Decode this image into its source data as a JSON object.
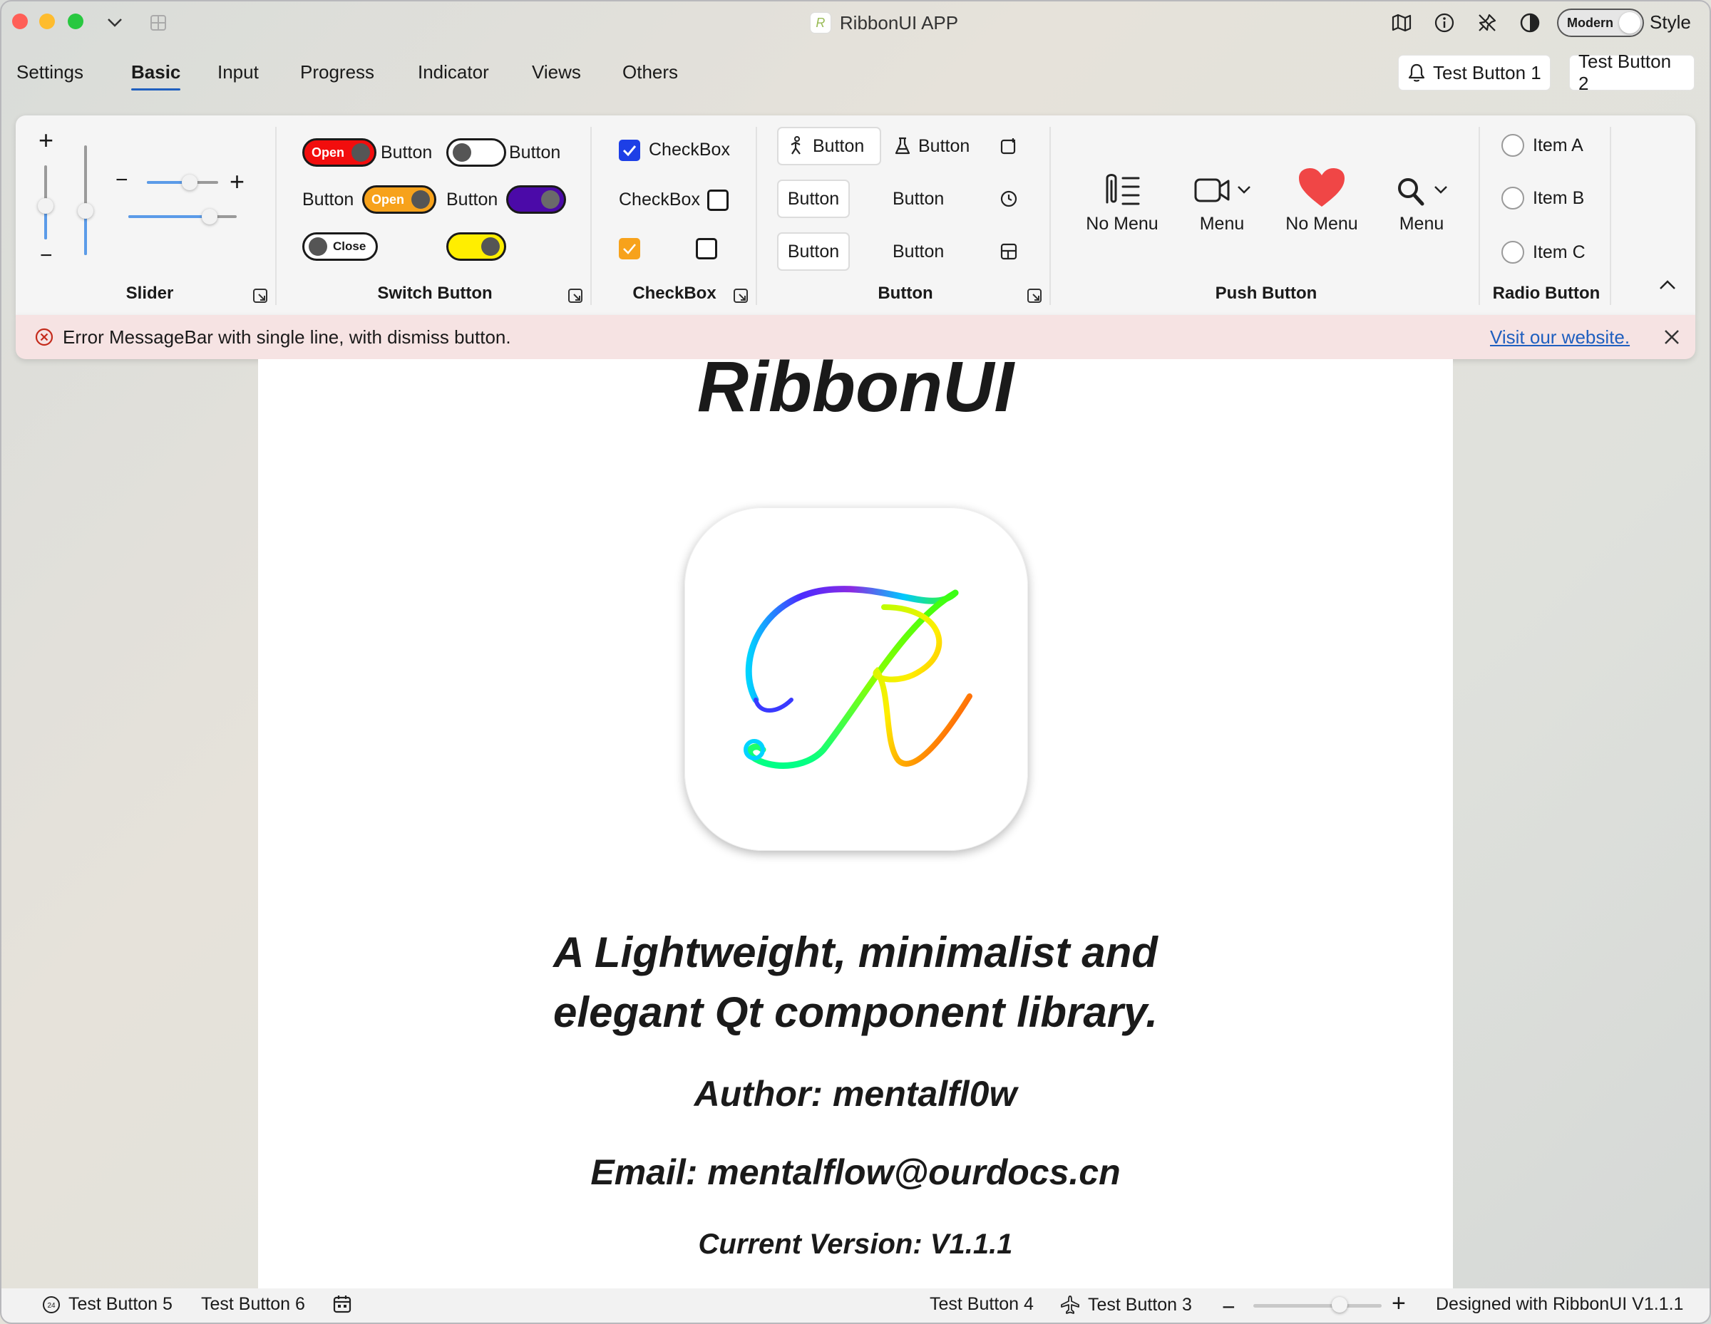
{
  "window": {
    "title": "RibbonUI APP",
    "style_toggle_text": "Modern",
    "style_label": "Style"
  },
  "tabs": [
    {
      "label": "Settings"
    },
    {
      "label": "Basic"
    },
    {
      "label": "Input"
    },
    {
      "label": "Progress"
    },
    {
      "label": "Indicator"
    },
    {
      "label": "Views"
    },
    {
      "label": "Others"
    }
  ],
  "top_buttons": {
    "btn1": "Test Button 1",
    "btn2": "Test Button 2"
  },
  "groups": {
    "slider": "Slider",
    "switch": "Switch Button",
    "checkbox": "CheckBox",
    "button": "Button",
    "push": "Push Button",
    "radio": "Radio Button"
  },
  "sliders": {
    "plus": "+",
    "minus": "−",
    "vertical_1_level": 0.45,
    "vertical_2_level": 0.4,
    "horizontal_1_level": 0.6,
    "horizontal_2_level": 0.75
  },
  "switches": {
    "open": "Open",
    "close": "Close",
    "button": "Button",
    "red": "#f20d0d",
    "orange": "#f7a21b",
    "purple": "#4b0aa8",
    "yellow": "#ffee00"
  },
  "checkboxes": {
    "label": "CheckBox"
  },
  "buttons": {
    "label": "Button"
  },
  "push_buttons": {
    "no_menu": "No Menu",
    "menu": "Menu"
  },
  "radios": {
    "a": "Item A",
    "b": "Item B",
    "c": "Item C"
  },
  "messagebar": {
    "text": "Error MessageBar with single line, with dismiss button.",
    "link": "Visit our website."
  },
  "page": {
    "title": "RibbonUI",
    "tagline_1": "A Lightweight, minimalist and",
    "tagline_2": "elegant Qt component library.",
    "author": "Author: mentalfl0w",
    "email": "Email: mentalflow@ourdocs.cn",
    "version": "Current Version: V1.1.1"
  },
  "statusbar": {
    "calendar_day": "24",
    "btn5": "Test Button 5",
    "btn6": "Test Button 6",
    "btn4": "Test Button 4",
    "btn3": "Test Button 3",
    "zoom_level": 0.67,
    "designed": "Designed with RibbonUI V1.1.1"
  },
  "colors": {
    "accent": "#1f5fbf",
    "error": "#c42b1c",
    "checkbox_blue": "#1d3fe6"
  }
}
